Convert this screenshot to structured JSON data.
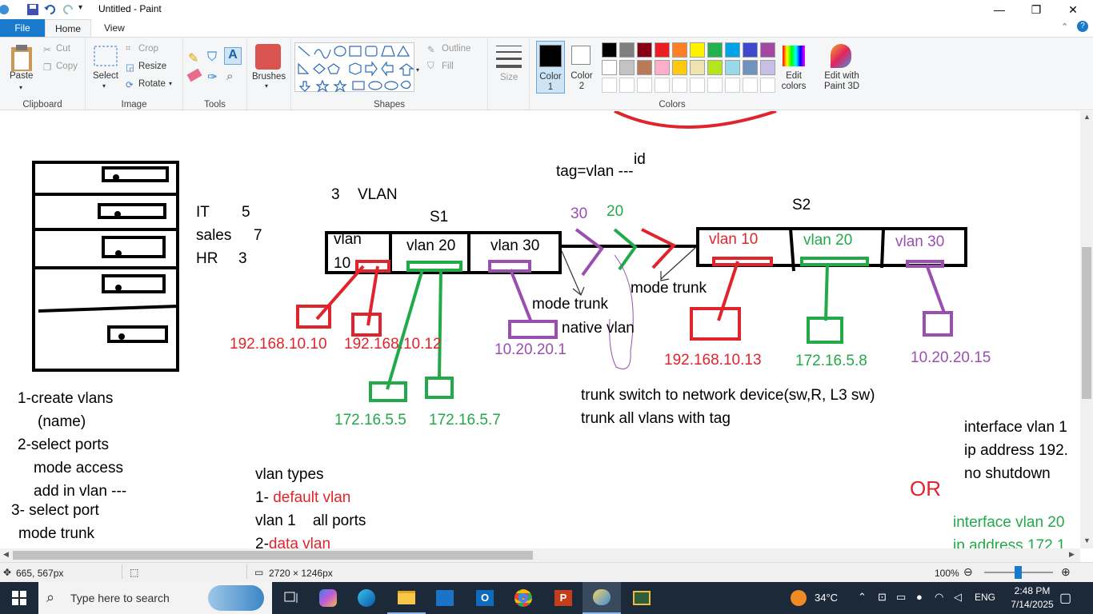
{
  "window": {
    "title": "Untitled - Paint"
  },
  "tabs": [
    {
      "label": "File"
    },
    {
      "label": "Home"
    },
    {
      "label": "View"
    }
  ],
  "ribbon": {
    "clipboard": {
      "paste": "Paste",
      "cut": "Cut",
      "copy": "Copy",
      "label": "Clipboard"
    },
    "image": {
      "select": "Select",
      "crop": "Crop",
      "resize": "Resize",
      "rotate": "Rotate",
      "label": "Image"
    },
    "tools": {
      "label": "Tools"
    },
    "brushes": {
      "label": "Brushes"
    },
    "shapes": {
      "outline": "Outline",
      "fill": "Fill",
      "label": "Shapes"
    },
    "size": {
      "label": "Size"
    },
    "colors": {
      "color1": "Color 1",
      "color2": "Color 2",
      "edit_colors": "Edit colors",
      "paint3d": "Edit with Paint 3D",
      "label": "Colors",
      "row1": [
        "#000000",
        "#7f7f7f",
        "#880015",
        "#ed1c24",
        "#ff7f27",
        "#fff200",
        "#22b14c",
        "#00a2e8",
        "#3f48cc",
        "#a349a4"
      ],
      "row2": [
        "#ffffff",
        "#c3c3c3",
        "#b97a57",
        "#ffaec9",
        "#ffc90e",
        "#efe4b0",
        "#b5e61d",
        "#99d9ea",
        "#7092be",
        "#c8bfe7"
      ]
    }
  },
  "canvas": {
    "it": "IT",
    "it_n": "5",
    "sales": "sales",
    "sales_n": "7",
    "hr": "HR",
    "hr_n": "3",
    "vlan_count": "3",
    "vlan_word": "VLAN",
    "s1": "S1",
    "s2": "S2",
    "s1_vlan10_a": "vlan",
    "s1_vlan10_b": "10",
    "s1_vlan20": "vlan 20",
    "s1_vlan30": "vlan 30",
    "s2_vlan10": "vlan 10",
    "s2_vlan20": "vlan 20",
    "s2_vlan30": "vlan 30",
    "tag": "tag=vlan ---",
    "tag_id": "id",
    "n30": "30",
    "n20": "20",
    "mode_trunk1": "mode trunk",
    "mode_trunk2": "mode trunk",
    "native_vlan": "native vlan",
    "ip1": "192.168.10.10",
    "ip2": "192.168.10.12",
    "ip3": "10.20.20.1",
    "ip4": "192.168.10.13",
    "ip5": "172.16.5.8",
    "ip6": "10.20.20.15",
    "ip7": "172.16.5.5",
    "ip8": "172.16.5.7",
    "trunk1": "trunk   switch to network device(sw,R, L3 sw)",
    "trunk2": "trunk all vlans with tag",
    "step1": "1-create vlans",
    "step1b": "(name)",
    "step2": "2-select ports",
    "step2b": "mode access",
    "step2c": "add in vlan ---",
    "step3": "3- select port",
    "step3b": "mode trunk",
    "types": "vlan types",
    "type1_prefix": "1- ",
    "type1": "default vlan",
    "vlan1": "vlan 1    all ports",
    "type2_prefix": "2-",
    "type2": "data vlan",
    "iface1": "interface vlan 1",
    "iface2": "ip address 192.",
    "iface3": "no shutdown",
    "or": "OR",
    "iface4": "interface vlan 20",
    "iface5": "ip address 172.1"
  },
  "status": {
    "cursor": "665, 567px",
    "size": "2720 × 1246px",
    "zoom": "100%"
  },
  "taskbar": {
    "search": "Type here to search",
    "temp": "34°C",
    "lang": "ENG",
    "time": "2:48 PM",
    "date": "7/14/2025"
  }
}
